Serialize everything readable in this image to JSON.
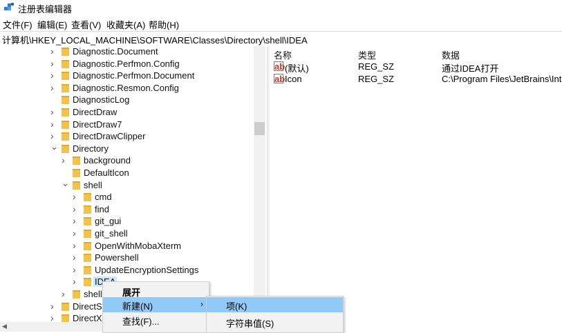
{
  "window": {
    "title": "注册表编辑器"
  },
  "menubar": [
    "文件(F)",
    "编辑(E)",
    "查看(V)",
    "收藏夹(A)",
    "帮助(H)"
  ],
  "address": "计算机\\HKEY_LOCAL_MACHINE\\SOFTWARE\\Classes\\Directory\\shell\\IDEA",
  "tree": [
    {
      "label": "Diagnostic.Document",
      "expander": "collapsed",
      "depth": 0
    },
    {
      "label": "Diagnostic.Perfmon.Config",
      "expander": "collapsed",
      "depth": 0
    },
    {
      "label": "Diagnostic.Perfmon.Document",
      "expander": "collapsed",
      "depth": 0
    },
    {
      "label": "Diagnostic.Resmon.Config",
      "expander": "collapsed",
      "depth": 0
    },
    {
      "label": "DiagnosticLog",
      "expander": "none",
      "depth": 0
    },
    {
      "label": "DirectDraw",
      "expander": "collapsed",
      "depth": 0
    },
    {
      "label": "DirectDraw7",
      "expander": "collapsed",
      "depth": 0
    },
    {
      "label": "DirectDrawClipper",
      "expander": "collapsed",
      "depth": 0
    },
    {
      "label": "Directory",
      "expander": "expanded",
      "depth": 0
    },
    {
      "label": "background",
      "expander": "collapsed",
      "depth": 1
    },
    {
      "label": "DefaultIcon",
      "expander": "none",
      "depth": 1
    },
    {
      "label": "shell",
      "expander": "expanded",
      "depth": 1
    },
    {
      "label": "cmd",
      "expander": "collapsed",
      "depth": 2
    },
    {
      "label": "find",
      "expander": "collapsed",
      "depth": 2
    },
    {
      "label": "git_gui",
      "expander": "collapsed",
      "depth": 2
    },
    {
      "label": "git_shell",
      "expander": "collapsed",
      "depth": 2
    },
    {
      "label": "OpenWithMobaXterm",
      "expander": "collapsed",
      "depth": 2
    },
    {
      "label": "Powershell",
      "expander": "collapsed",
      "depth": 2
    },
    {
      "label": "UpdateEncryptionSettings",
      "expander": "collapsed",
      "depth": 2
    },
    {
      "label": "IDEA",
      "expander": "collapsed",
      "depth": 2,
      "selected": true
    },
    {
      "label": "shell",
      "expander": "collapsed",
      "depth": 1
    },
    {
      "label": "DirectS",
      "expander": "collapsed",
      "depth": 0
    },
    {
      "label": "DirectX",
      "expander": "collapsed",
      "depth": 0
    }
  ],
  "values_header": {
    "name": "名称",
    "type": "类型",
    "data": "数据"
  },
  "values": [
    {
      "name": "(默认)",
      "type": "REG_SZ",
      "data": "通过IDEA打开",
      "icon": "ab"
    },
    {
      "name": "Icon",
      "type": "REG_SZ",
      "data": "C:\\Program Files\\JetBrains\\Inte",
      "icon": "ab"
    }
  ],
  "context_menu": [
    {
      "label": "展开",
      "bold": true
    },
    {
      "label": "新建(N)",
      "highlighted": true,
      "submenu": true
    },
    {
      "label": "查找(F)..."
    }
  ],
  "submenu": [
    {
      "label": "项(K)",
      "highlighted": true
    },
    {
      "label": "字符串值(S)"
    }
  ],
  "colors": {
    "highlight": "#91c9f7",
    "selection": "#cce8ff",
    "folder": "#f3c24a"
  }
}
